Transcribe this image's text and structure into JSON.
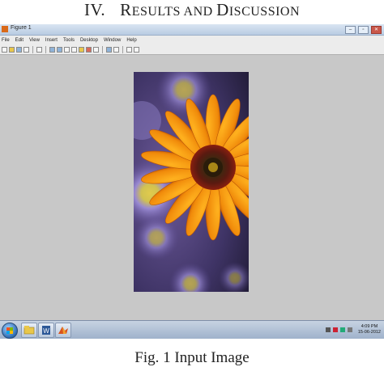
{
  "heading": {
    "numeral": "IV.",
    "title_parts": [
      {
        "text": "R",
        "size": "big"
      },
      {
        "text": "ESULTS AND ",
        "size": "sc"
      },
      {
        "text": "D",
        "size": "big"
      },
      {
        "text": "ISCUSSION",
        "size": "sc"
      }
    ]
  },
  "window": {
    "title": "Figure 1",
    "menu": [
      "File",
      "Edit",
      "View",
      "Insert",
      "Tools",
      "Desktop",
      "Window",
      "Help"
    ],
    "controls": {
      "minimize": "–",
      "maximize": "▫",
      "close": "✕"
    },
    "toolbar_icons": [
      "new-file-icon",
      "open-folder-icon",
      "save-icon",
      "print-icon",
      "edit-plot-icon",
      "zoom-in-icon",
      "zoom-out-icon",
      "pan-icon",
      "rotate-icon",
      "data-cursor-icon",
      "brush-icon",
      "link-icon",
      "colorbar-icon",
      "legend-icon",
      "hide-plot-tools-icon",
      "show-plot-tools-icon"
    ]
  },
  "taskbar": {
    "apps": [
      "explorer-icon",
      "word-icon",
      "matlab-icon"
    ],
    "clock_time": "4:09 PM",
    "clock_date": "15-06-2012"
  },
  "caption": "Fig. 1 Input Image"
}
